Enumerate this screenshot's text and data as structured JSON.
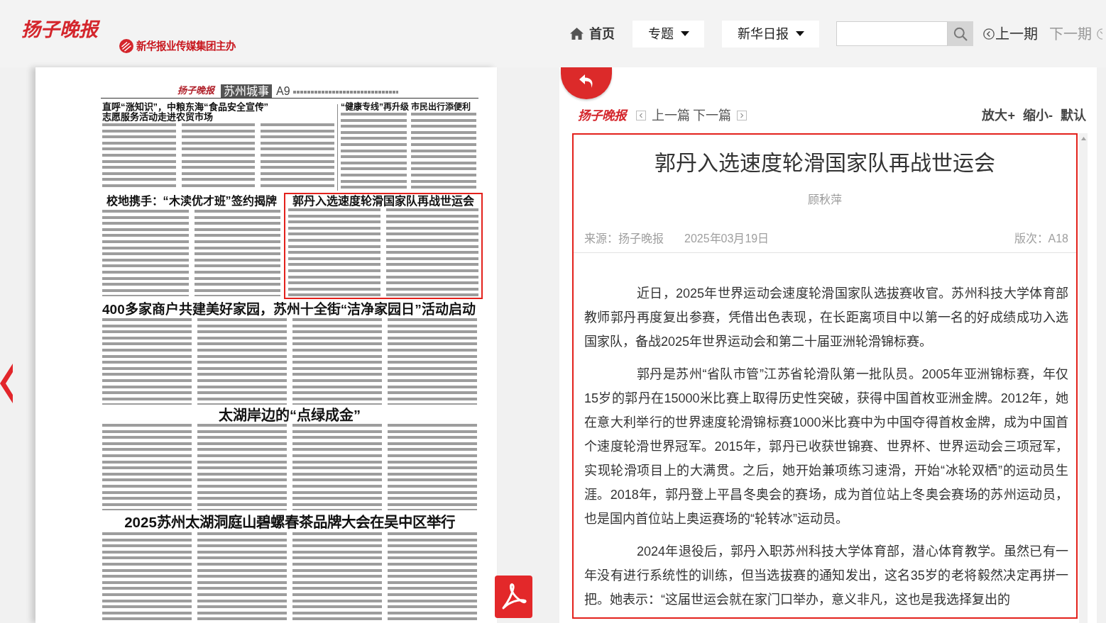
{
  "header": {
    "logo": "扬子晚报",
    "publisher": "新华报业传媒集团主办"
  },
  "nav": {
    "home": "首页",
    "menus": [
      {
        "label": "专题"
      },
      {
        "label": "新华日报"
      }
    ],
    "prev_issue": {
      "label": "上一期",
      "disabled": false
    },
    "next_issue": {
      "label": "下一期",
      "disabled": true
    }
  },
  "newspaper_page": {
    "logo": "扬子晚报",
    "section": "苏州城事",
    "page_number": "A9",
    "articles": [
      {
        "headline": [
          "直呼“涨知识”，中粮东海“食品安全宣传”",
          "志愿服务活动走进农贸市场"
        ],
        "selected": false
      },
      {
        "headline": [
          "“健康专线”再升级 市民出行添便利"
        ],
        "selected": false
      },
      {
        "headline": [
          "校地携手：“木渎优才班”签约揭牌"
        ],
        "selected": false
      },
      {
        "headline": [
          "郭丹入选速度轮滑国家队再战世运会"
        ],
        "selected": true
      },
      {
        "headline": [
          "400多家商户共建美好家园，苏州十全街“洁净家园日”活动启动"
        ],
        "selected": false
      },
      {
        "headline": [
          "太湖岸边的“点绿成金”"
        ],
        "selected": false
      },
      {
        "headline": [
          "2025苏州太湖洞庭山碧螺春茶品牌大会在吴中区举行"
        ],
        "selected": false
      }
    ]
  },
  "article_view": {
    "logo": "扬子晚报",
    "prev_article": "上一篇",
    "next_article": "下一篇",
    "text_size_controls": [
      "放大+",
      "缩小-",
      "默认"
    ],
    "title": "郭丹入选速度轮滑国家队再战世运会",
    "author": "顾秋萍",
    "source": "来源：扬子晚报",
    "date": "2025年03月19日",
    "page": "版次：A18",
    "paragraphs": [
      "近日，2025年世界运动会速度轮滑国家队选拔赛收官。苏州科技大学体育部教师郭丹再度复出参赛，凭借出色表现，在长距离项目中以第一名的好成绩成功入选国家队，备战2025年世界运动会和第二十届亚洲轮滑锦标赛。",
      "郭丹是苏州“省队市管”江苏省轮滑队第一批队员。2005年亚洲锦标赛，年仅15岁的郭丹在15000米比赛上取得历史性突破，获得中国首枚亚洲金牌。2012年，她在意大利举行的世界速度轮滑锦标赛1000米比赛中为中国夺得首枚金牌，成为中国首个速度轮滑世界冠军。2015年，郭丹已收获世锦赛、世界杯、世界运动会三项冠军，实现轮滑项目上的大满贯。之后，她开始兼项练习速滑，开始“冰轮双栖”的运动员生涯。2018年，郭丹登上平昌冬奥会的赛场，成为首位站上冬奥会赛场的苏州运动员，也是国内首位站上奥运赛场的“轮转冰”运动员。",
      "2024年退役后，郭丹入职苏州科技大学体育部，潜心体育教学。虽然已有一年没有进行系统性的训练，但当选拔赛的通知发出，这名35岁的老将毅然决定再拼一把。她表示：“这届世运会就在家门口举办，意义非凡，这也是我选择复出的"
    ]
  }
}
